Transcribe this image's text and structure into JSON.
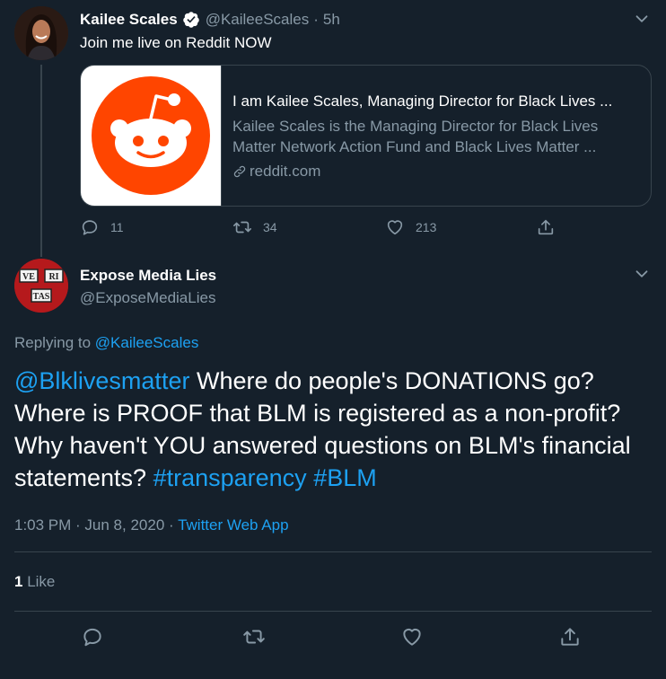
{
  "parent": {
    "name": "Kailee Scales",
    "handle": "@KaileeScales",
    "time": "5h",
    "text": "Join me live on Reddit NOW",
    "card": {
      "title": "I am Kailee Scales, Managing Director for Black Lives ...",
      "description": "Kailee Scales is the Managing Director for Black Lives Matter Network Action Fund and Black Lives Matter ...",
      "domain": "reddit.com"
    },
    "replies": "11",
    "retweets": "34",
    "likes": "213"
  },
  "main": {
    "name": "Expose Media Lies",
    "handle": "@ExposeMediaLies",
    "replying_prefix": "Replying to ",
    "replying_to": "@KaileeScales",
    "mention": "@Blklivesmatter",
    "text": " Where do people's DONATIONS go? Where is PROOF that BLM is registered as a non-profit? Why haven't YOU answered questions on BLM's financial statements?  ",
    "hashtag1": "#transparency",
    "hashtag2": "#BLM",
    "timestamp": "1:03 PM · Jun 8, 2020 · ",
    "source": "Twitter Web App",
    "like_count": "1",
    "like_label": " Like",
    "avatar_text": [
      "VE",
      "RI",
      "TAS"
    ]
  },
  "colors": {
    "background": "#15202b",
    "accent": "#1da1f2",
    "muted": "#8899a6",
    "reddit": "#ff4500"
  }
}
